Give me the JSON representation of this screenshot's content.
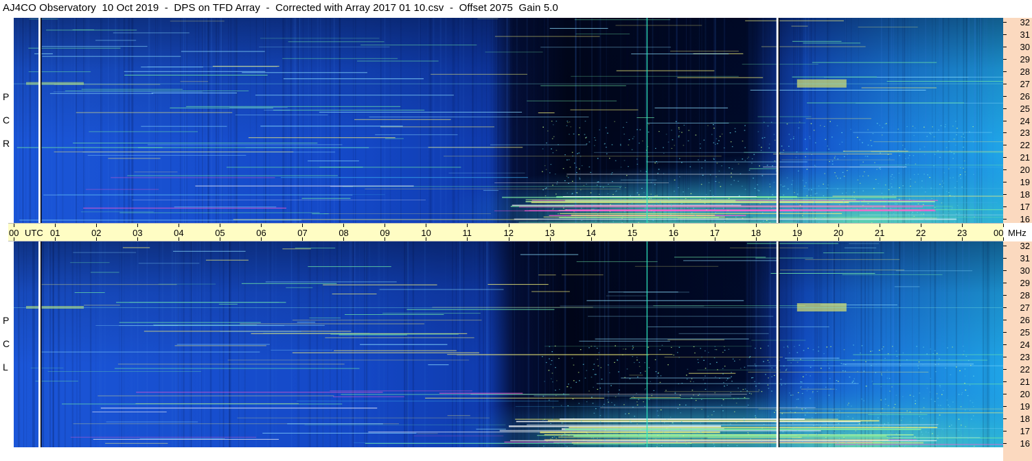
{
  "title": "AJ4CO Observatory  10 Oct 2019  -  DPS on TFD Array  -  Corrected with Array 2017 01 10.csv  -  Offset 2075  Gain 5.0",
  "panels": [
    {
      "label_letters": [
        "P",
        "C",
        "R"
      ]
    },
    {
      "label_letters": [
        "P",
        "C",
        "L"
      ]
    }
  ],
  "time_axis": {
    "labels": [
      "00",
      "01",
      "02",
      "03",
      "04",
      "05",
      "06",
      "07",
      "08",
      "09",
      "10",
      "11",
      "12",
      "13",
      "14",
      "15",
      "16",
      "17",
      "18",
      "19",
      "20",
      "21",
      "22",
      "23",
      "00"
    ],
    "start_unit": "UTC",
    "end_unit": "MHz"
  },
  "chart_data": {
    "type": "heatmap",
    "title": "AJ4CO Observatory  10 Oct 2019  -  DPS on TFD Array  -  Corrected with Array 2017 01 10.csv  -  Offset 2075  Gain 5.0",
    "x_unit": "UTC",
    "y_unit": "MHz",
    "x_range": [
      0,
      24
    ],
    "y_range": [
      16,
      32
    ],
    "y_ticks": [
      "32",
      "31",
      "30",
      "29",
      "28",
      "27",
      "26",
      "25",
      "24",
      "23",
      "22",
      "21",
      "20",
      "19",
      "18",
      "17",
      "16"
    ],
    "series": [
      {
        "name": "RCP",
        "panel": "top"
      },
      {
        "name": "LCP",
        "panel": "bottom"
      }
    ],
    "colors": {
      "background_low": "#000a3c",
      "background_mid": "#1246c8",
      "background_high": "#1c96e0",
      "signal": "#7ee8a0",
      "intense": "#f4f07a",
      "timeband": "#fffdc4",
      "freqband": "#fbd9bf"
    }
  }
}
